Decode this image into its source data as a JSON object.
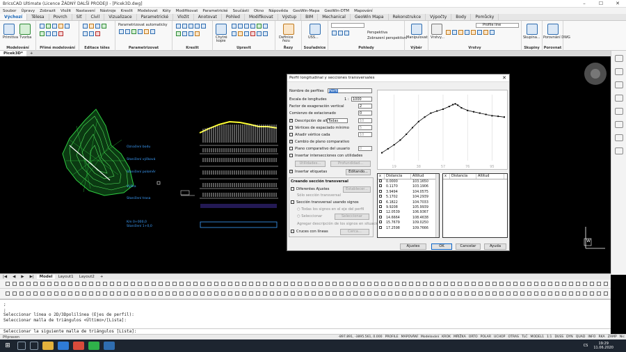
{
  "window": {
    "title": "BricsCAD Ultimate (Licence ŽÁDNÝ DALŠÍ PRODEJ) - [Picek3D.dwg]",
    "controls": [
      "–",
      "☐",
      "✕"
    ]
  },
  "menu": [
    "Soubor",
    "Úpravy",
    "Zobrazit",
    "Vložit",
    "Nastavení",
    "Nástroje",
    "Kreslit",
    "Modelovat",
    "Kóty",
    "Modifikovat",
    "Parametrické",
    "Součásti",
    "Okno",
    "Nápověda",
    "GeoWin-Mapa",
    "GeoWin-DTM",
    "Mapování"
  ],
  "ribbon_tabs": [
    "Výchozí",
    "Tělesa",
    "Povrch",
    "Síť",
    "Civil",
    "Vizualizace",
    "Parametrické",
    "Vložit",
    "Anotovat",
    "Pohled",
    "Modifikovat",
    "Výstup",
    "BIM",
    "Mechanical",
    "GeoWin Mapa",
    "Rekonstrukce",
    "Výpočty",
    "Body",
    "Pomůcky"
  ],
  "ribbon_panels": {
    "modelovani": {
      "label": "Modelování",
      "b1": "Primitiva",
      "b2": "Tvorba"
    },
    "prime": {
      "label": "Přímé modelování"
    },
    "editace": {
      "label": "Editace těles"
    },
    "param": {
      "label": "Parametrizovat",
      "auto": "Parametrizovat automaticky"
    },
    "kreslit": {
      "label": "Kreslit"
    },
    "upravit": {
      "label": "Upravit",
      "chytre": "Chytré",
      "kopie": "kopie"
    },
    "rezy": {
      "label": "Řezy",
      "definice": "Definice",
      "rezu": "řezu"
    },
    "souradnice": {
      "label": "Souřadnice",
      "uss": "USS..."
    },
    "pohledy": {
      "label": "Pohledy",
      "persp": "Perspektiva",
      "zar": "Zobrazení perspektivní"
    },
    "vyber": {
      "label": "Výběr",
      "manip": "Manipulovat"
    },
    "vrstvy": {
      "label": "Vrstvy",
      "vrstvy": "Vrstvy...",
      "profile": "Profile line"
    },
    "skupiny": {
      "label": "Skupiny",
      "sk": "Skupina..."
    },
    "porovnat": {
      "label": "Porovnat",
      "dwg": "Porovnání DWG"
    }
  },
  "doc_tabs": [
    "Picek3D*",
    "+"
  ],
  "canvas_labels": {
    "l1": "Označení bodu",
    "l2": "Staničení výšková",
    "l3": "Staničení poloměr",
    "l4": "Výška",
    "l5": "Staničení trasa",
    "l6": "Km 0+000,0",
    "l7": "Staničení 1+0,0",
    "compass_w": "W"
  },
  "dialog": {
    "title": "Perfil longitudinal y secciones transversales",
    "nombre_lbl": "Nombre de perfiles",
    "nombre_val": "Perfil",
    "escala_lbl": "Escala de longitudes",
    "escala_pre": "1 :",
    "escala_val": "1000",
    "factor_lbl": "Factor de exageración vertical",
    "factor_val": "2",
    "comienzo_lbl": "Comienzo de estacionado",
    "comienzo_val": "0",
    "desc_altura": "Descripción de altura",
    "todas": "Todas",
    "n10": "10",
    "vertices_lbl": "Vértices de espaciado mínimo",
    "n5": "5",
    "anadir_lbl": "Añadir vértice cada",
    "n10b": "10",
    "cambio_lbl": "Cambio de plano comparativo",
    "plano_lbl": "Plano comparativo del usuario",
    "n0": "0",
    "insertar_int": "Insertar intersecciones con utilidades",
    "utilidades_btn": "Utilidades...",
    "profundidad_btn": "Profundidad...",
    "insertar_et": "Insertar etiquetas",
    "editando_btn": "Editando...",
    "creando_hdr": "Creando sección transversal",
    "dif_ajustes": "Diferentes Ajustes",
    "establecer_btn": "Establecer...",
    "solo_sec": "Sólo sección transversal",
    "sec_signos": "Sección transversal usando signos",
    "todas_signos": "Todas los signos en el eje del perfil",
    "seleccionar": "Seleccionar",
    "seleccionar_btn": "Seleccionar",
    "agregar_desc": "Agregar descripción de los signos en situación",
    "cruces": "Cruces con líneas",
    "cerca_btn": "Cerca...",
    "hdr_x": "x",
    "hdr_dist": "Distancia",
    "hdr_alt": "Altitud",
    "ajustes_btn": "Ajustes",
    "ok_btn": "OK",
    "cancelar_btn": "Cancelar",
    "ayuda_btn": "Ayuda"
  },
  "profile_rows": [
    {
      "d": "0.0000",
      "a": "103.1650"
    },
    {
      "d": "0.1170",
      "a": "103.1906"
    },
    {
      "d": "3.9494",
      "a": "104.0575"
    },
    {
      "d": "5.1702",
      "a": "104.2939"
    },
    {
      "d": "6.1822",
      "a": "104.7033"
    },
    {
      "d": "9.9208",
      "a": "105.9939"
    },
    {
      "d": "12.0539",
      "a": "106.9367"
    },
    {
      "d": "14.6664",
      "a": "108.4638"
    },
    {
      "d": "15.7679",
      "a": "109.0250"
    },
    {
      "d": "17.2598",
      "a": "109.7666"
    }
  ],
  "chart_data": {
    "type": "line",
    "title": "",
    "xlabel": "",
    "ylabel": "",
    "x": [
      0,
      5,
      10,
      15,
      20,
      25,
      30,
      35,
      40,
      45,
      50,
      55,
      58,
      60,
      62,
      65,
      70,
      75,
      80,
      85,
      90,
      95,
      100
    ],
    "y": [
      100.0,
      101.5,
      103.0,
      104.8,
      107.0,
      109.5,
      111.8,
      113.5,
      115.0,
      115.8,
      116.5,
      117.5,
      118.2,
      118.5,
      118.0,
      117.0,
      116.0,
      115.5,
      115.0,
      114.5,
      114.0,
      113.8,
      113.5
    ],
    "xticks": [
      "19",
      "38",
      "57",
      "76",
      "95"
    ],
    "ylim": [
      97,
      122
    ],
    "grid": true
  },
  "command": {
    "lines": [
      ";",
      ";",
      "Seleccionar línea o 2D/3Dpolilínea (Ejes de perfil):",
      "Seleccionar malla de triángulos <Último>/[Lista]:"
    ],
    "prompt": "Seleccionar la siguiente malla de triángulos [Lista]:"
  },
  "layout_tabs": [
    "Model",
    "Layout1",
    "Layout2",
    "+"
  ],
  "status": {
    "left": "Připraven",
    "coords": "-897.891, -3895.561, 0.000",
    "toggles": [
      "PROFILE",
      "MAPOVÁNÍ",
      "Modelování",
      "KROK",
      "MŘÍŽKA",
      "ORTO",
      "POLAR",
      "UCHOP",
      "OTRAS",
      "TLČ",
      "MODEL1",
      "1:1",
      "DUSS",
      "DYN",
      "QUAD",
      "INFO",
      "RKA",
      "ZAMP",
      "Nic"
    ]
  },
  "taskbar": {
    "time": "19:29",
    "date": "11.06.2020",
    "lang": "CS"
  }
}
